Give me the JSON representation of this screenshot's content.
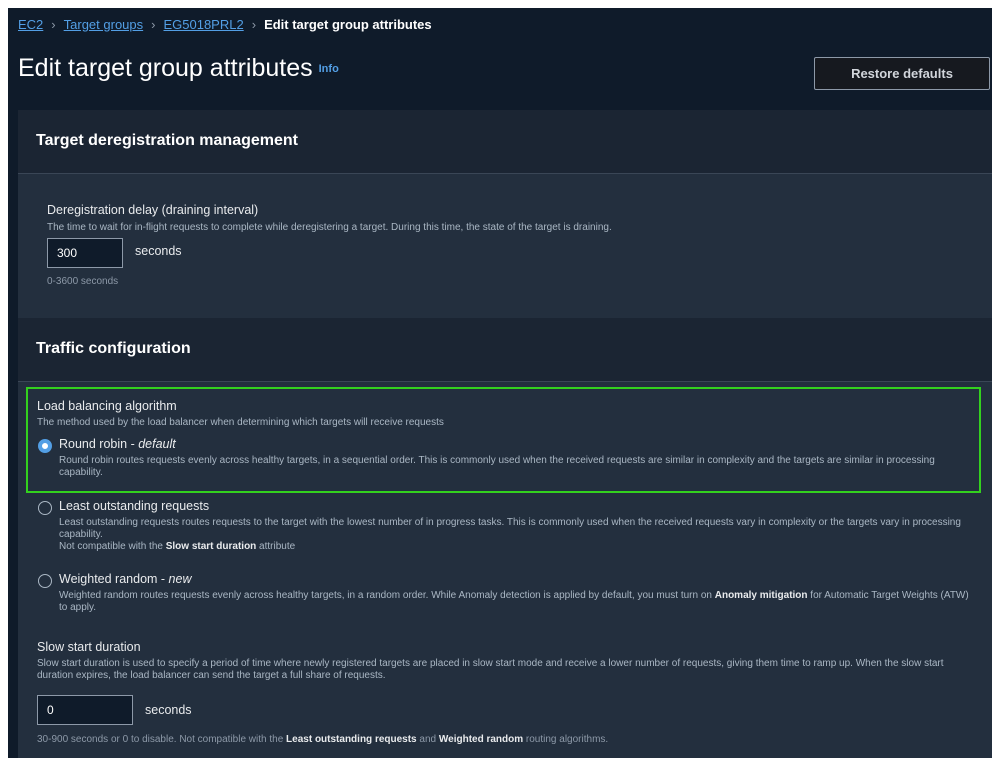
{
  "breadcrumb": {
    "items": [
      "EC2",
      "Target groups",
      "EG5018PRL2"
    ],
    "current": "Edit target group attributes"
  },
  "header": {
    "title": "Edit target group attributes",
    "info": "Info",
    "restore_label": "Restore defaults"
  },
  "deregistration": {
    "section_title": "Target deregistration management",
    "field_label": "Deregistration delay (draining interval)",
    "field_desc": "The time to wait for in-flight requests to complete while deregistering a target. During this time, the state of the target is draining.",
    "value": "300",
    "unit": "seconds",
    "hint": "0-3600 seconds"
  },
  "traffic": {
    "section_title": "Traffic configuration",
    "algorithm_label": "Load balancing algorithm",
    "algorithm_desc": "The method used by the load balancer when determining which targets will receive requests",
    "options": [
      {
        "name": "Round robin",
        "suffix": "default",
        "checked": true,
        "desc": "Round robin routes requests evenly across healthy targets, in a sequential order. This is commonly used when the received requests are similar in complexity and the targets are similar in processing capability."
      },
      {
        "name": "Least outstanding requests",
        "suffix": "",
        "checked": false,
        "desc": "Least outstanding requests routes requests to the target with the lowest number of in progress tasks. This is commonly used when the received requests vary in complexity or the targets vary in processing capability.",
        "note_prefix": "Not compatible with the ",
        "note_bold": "Slow start duration",
        "note_suffix": " attribute"
      },
      {
        "name": "Weighted random",
        "suffix": "new",
        "checked": false,
        "desc_prefix": "Weighted random routes requests evenly across healthy targets, in a random order. While Anomaly detection is applied by default, you must turn on ",
        "desc_bold": "Anomaly mitigation",
        "desc_suffix": " for Automatic Target Weights (ATW) to apply."
      }
    ],
    "slow_start": {
      "label": "Slow start duration",
      "desc": "Slow start duration is used to specify a period of time where newly registered targets are placed in slow start mode and receive a lower number of requests, giving them time to ramp up. When the slow start duration expires, the load balancer can send the target a full share of requests.",
      "value": "0",
      "unit": "seconds",
      "hint_prefix": "30-900 seconds or 0 to disable. Not compatible with the ",
      "hint_bold1": "Least outstanding requests",
      "hint_mid": " and ",
      "hint_bold2": "Weighted random",
      "hint_suffix": " routing algorithms."
    }
  }
}
